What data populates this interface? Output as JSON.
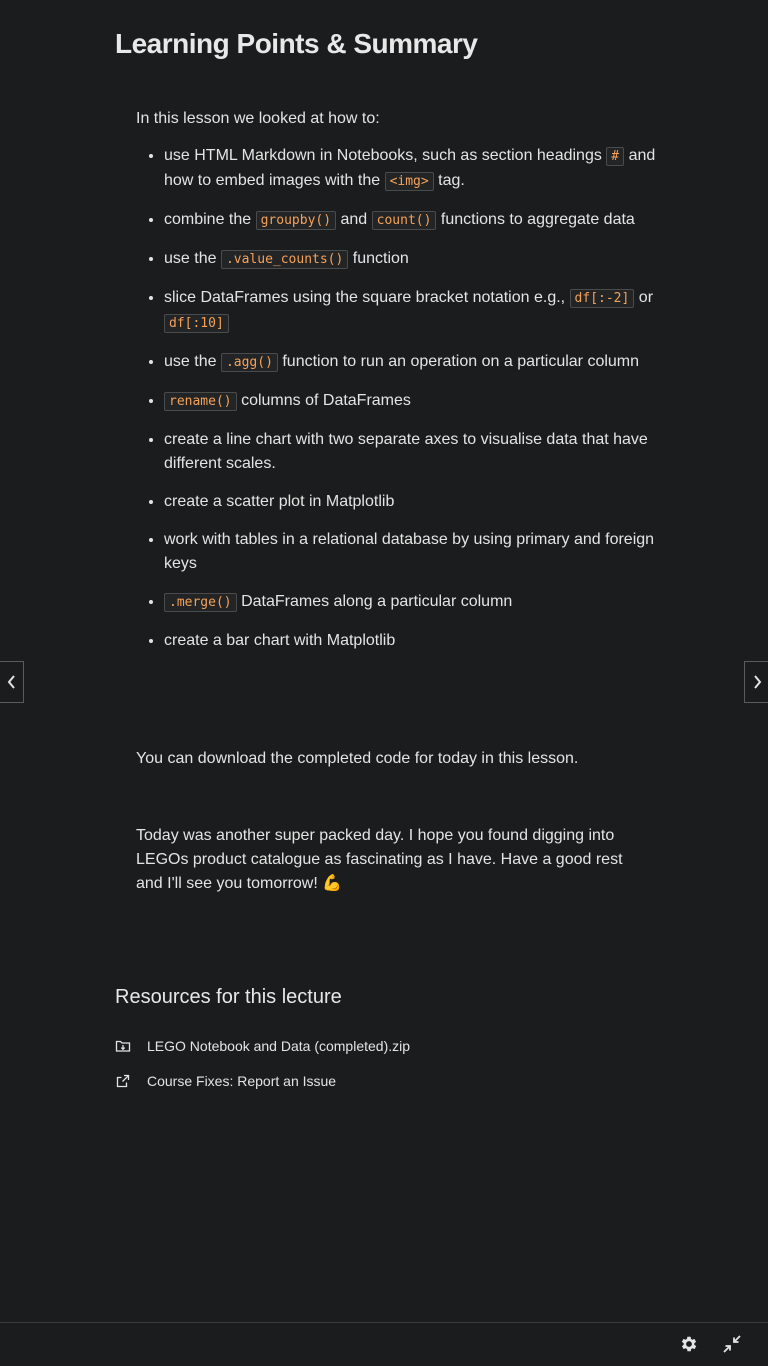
{
  "lecture": {
    "title": "Learning Points & Summary",
    "lead": "In this lesson we looked at how to:",
    "points": [
      {
        "pre": "use HTML Markdown in Notebooks, such as section headings ",
        "code1": "#",
        "mid": " and how to embed images with the ",
        "code2": "<img>",
        "post": " tag."
      },
      {
        "pre": "combine the ",
        "code1": "groupby()",
        "mid": " and ",
        "code2": "count()",
        "post": " functions to aggregate data"
      },
      {
        "pre": "use the ",
        "code1": ".value_counts()",
        "post": " function"
      },
      {
        "pre": "slice DataFrames using the square bracket notation e.g., ",
        "code1": "df[:-2]",
        "mid": " or ",
        "code2": "df[:10]"
      },
      {
        "pre": "use the ",
        "code1": ".agg()",
        "post": " function to run an operation on a particular column"
      },
      {
        "code1": "rename()",
        "post": " columns of DataFrames"
      },
      {
        "text": "create a line chart with two separate axes to visualise data that have different scales."
      },
      {
        "text": "create a scatter plot in Matplotlib"
      },
      {
        "text": "work with tables in a relational database by using primary and foreign keys"
      },
      {
        "code1": ".merge()",
        "post": " DataFrames along a particular column"
      },
      {
        "text": "create a bar chart with Matplotlib"
      }
    ],
    "download_text": "You can download the completed code for today in this lesson.",
    "closing_text": "Today was another super packed day. I hope you found digging into LEGOs product catalogue as fascinating as I have. Have a good rest and I'll see you tomorrow! 💪"
  },
  "resources": {
    "title": "Resources for this lecture",
    "items": [
      {
        "label": "LEGO Notebook and Data (completed).zip",
        "icon": "folder-download-icon"
      },
      {
        "label": "Course Fixes: Report an Issue",
        "icon": "external-link-icon"
      }
    ]
  },
  "navigation": {
    "prev_icon": "chevron-left-icon",
    "next_icon": "chevron-right-icon"
  },
  "footer": {
    "settings_icon": "gear-icon",
    "exit_fullscreen_icon": "collapse-icon"
  },
  "colors": {
    "background": "#1b1c1d",
    "text": "#e4e4e4",
    "code": "#f4a259"
  }
}
